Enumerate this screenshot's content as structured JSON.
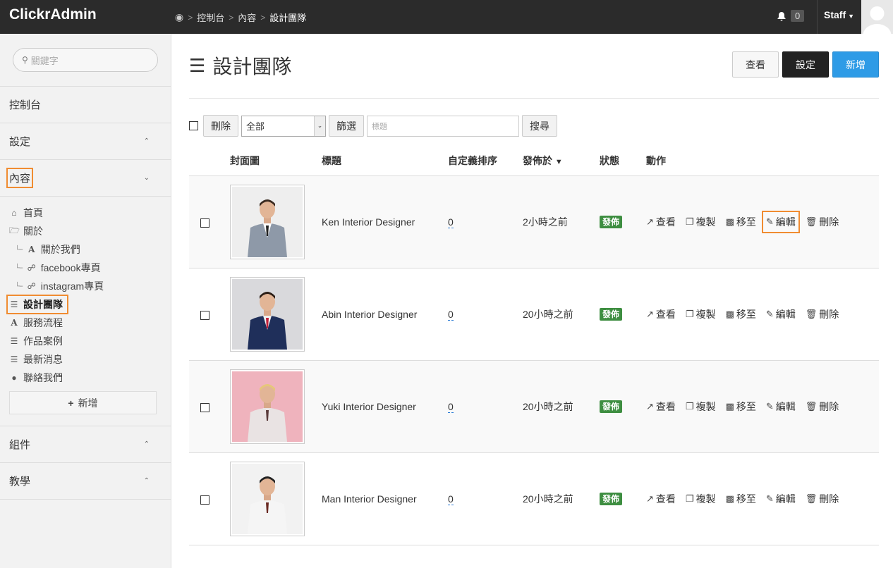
{
  "app": {
    "brand": "ClickrAdmin"
  },
  "breadcrumb": {
    "items": [
      "控制台",
      "內容",
      "設計團隊"
    ],
    "separator": ">"
  },
  "topbar": {
    "notif_count": "0",
    "user_label": "Staff"
  },
  "sidebar": {
    "search_placeholder": "關鍵字",
    "sections": {
      "dashboard": "控制台",
      "settings": "設定",
      "content": "內容",
      "components": "組件",
      "tutorial": "教學"
    },
    "content_items": {
      "home": "首頁",
      "about": "關於",
      "about_us": "關於我們",
      "facebook": "facebook專頁",
      "instagram": "instagram專頁",
      "design_team": "設計團隊",
      "service_flow": "服務流程",
      "portfolio": "作品案例",
      "news": "最新消息",
      "contact": "聯絡我們"
    },
    "add_label": "新增"
  },
  "page": {
    "title": "設計團隊",
    "buttons": {
      "view": "查看",
      "settings": "設定",
      "add": "新增"
    }
  },
  "toolbar": {
    "delete_label": "刪除",
    "filter_value": "全部",
    "filter_button": "篩選",
    "keyword_placeholder": "標題",
    "search_button": "搜尋"
  },
  "table": {
    "columns": {
      "cover": "封面圖",
      "title": "標題",
      "order": "自定義排序",
      "published_at": "發佈於",
      "published_sort": "▼",
      "status": "狀態",
      "actions": "動作"
    },
    "actions": {
      "view": "查看",
      "copy": "複製",
      "move": "移至",
      "edit": "編輯",
      "delete": "刪除"
    },
    "rows": [
      {
        "title": "Ken Interior Designer",
        "order": "0",
        "published": "2小時之前",
        "status": "發佈"
      },
      {
        "title": "Abin Interior Designer",
        "order": "0",
        "published": "20小時之前",
        "status": "發佈"
      },
      {
        "title": "Yuki Interior Designer",
        "order": "0",
        "published": "20小時之前",
        "status": "發佈"
      },
      {
        "title": "Man Interior Designer",
        "order": "0",
        "published": "20小時之前",
        "status": "發佈"
      }
    ]
  },
  "colors": {
    "topbar": "#2b2b2b",
    "highlight": "#f08c31",
    "primary": "#2e9be6",
    "status_green": "#3e8e41"
  }
}
